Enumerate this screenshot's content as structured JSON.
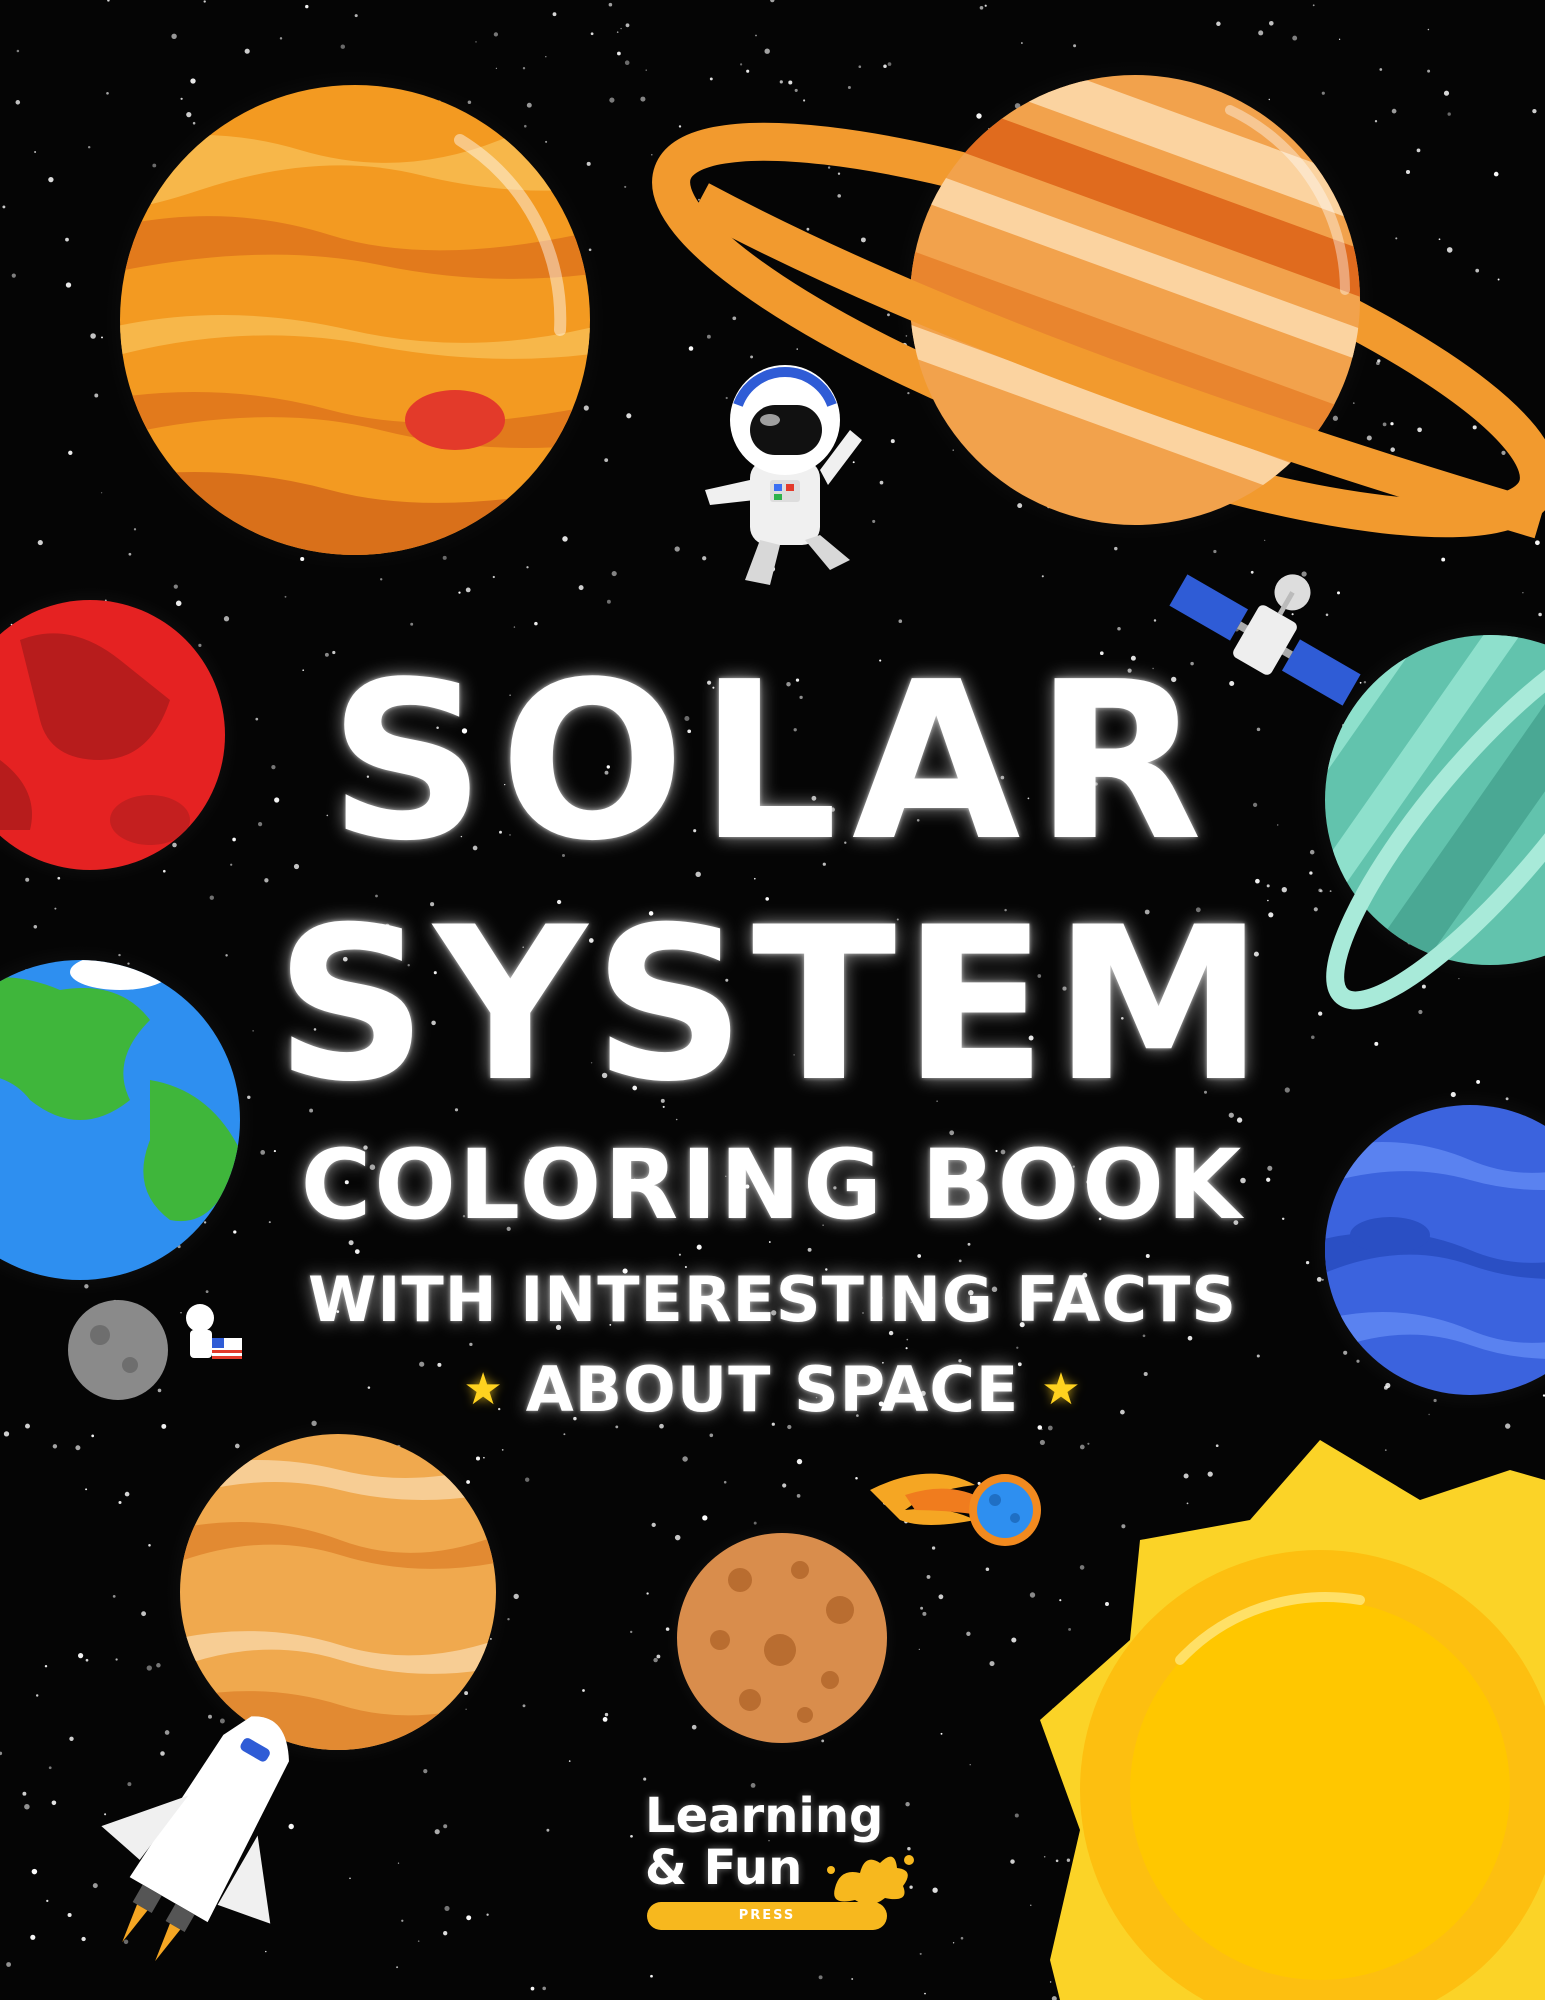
{
  "cover": {
    "title_line1": "SOLAR",
    "title_line2": "SYSTEM",
    "subtitle_line1": "COLORING BOOK",
    "subtitle_line2": "WITH INTERESTING FACTS",
    "subtitle_line3": "ABOUT SPACE",
    "star_glyph": "★"
  },
  "publisher_logo": {
    "line1": "Learning",
    "line2": "& Fun",
    "tag": "PRESS",
    "accent_color": "#f7b81e"
  },
  "colors": {
    "background": "#050505",
    "title_text": "#ffffff",
    "star_accent": "#ffd21f"
  },
  "illustrations": [
    "jupiter-planet",
    "saturn-planet",
    "astronaut",
    "satellite",
    "mars-planet",
    "uranus-planet",
    "earth-planet",
    "neptune-planet",
    "moon-with-astronaut",
    "venus-planet",
    "mercury-planet",
    "comet",
    "sun",
    "space-shuttle"
  ]
}
